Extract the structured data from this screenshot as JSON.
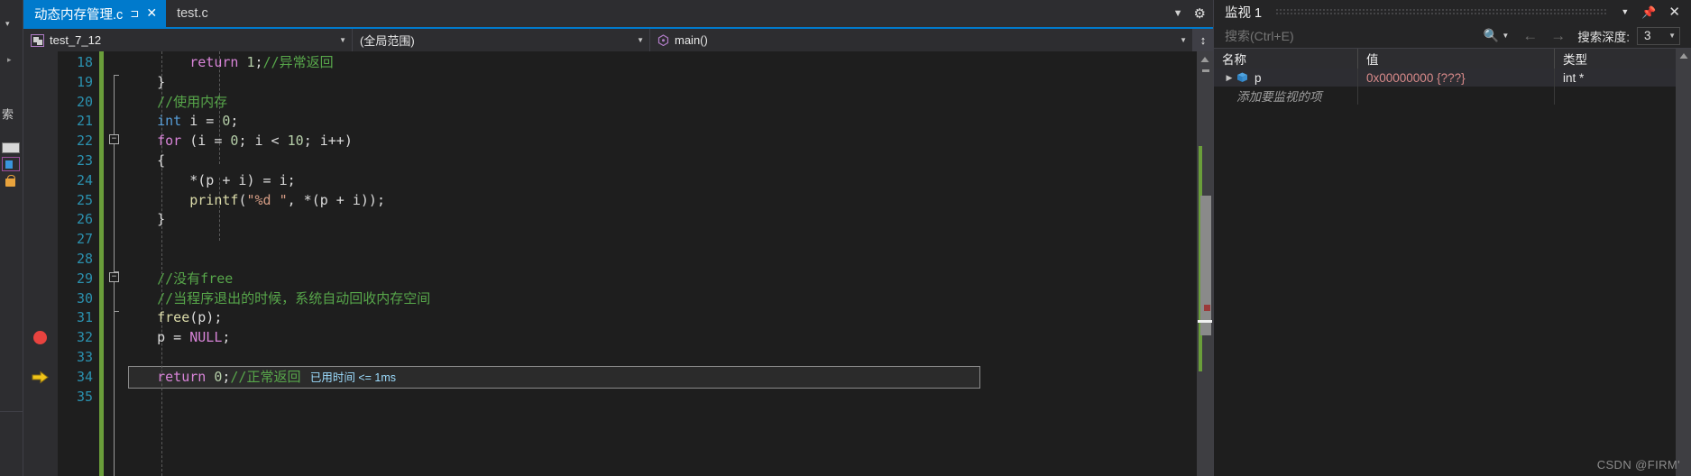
{
  "left_strip": {
    "vertical_text": "索"
  },
  "tabs": [
    {
      "label": "动态内存管理.c",
      "active": true,
      "pin_icon": "pin-icon",
      "close_icon": "close-icon"
    },
    {
      "label": "test.c",
      "active": false
    }
  ],
  "tabstrip_actions": {
    "dropdown_icon": "chevron-down-icon",
    "settings_icon": "gear-icon"
  },
  "navbar": {
    "project": "test_7_12",
    "project_icon": "project-icon",
    "scope": "(全局范围)",
    "member": "main()",
    "member_icon": "method-icon",
    "dropdown_icon": "chevron-down-icon",
    "split_icon": "split-window-icon"
  },
  "editor": {
    "first_line": 18,
    "lines": [
      {
        "n": 18,
        "tokens": [
          {
            "t": "        ",
            "c": "plain"
          },
          {
            "t": "return",
            "c": "kw"
          },
          {
            "t": " ",
            "c": "plain"
          },
          {
            "t": "1",
            "c": "num"
          },
          {
            "t": ";",
            "c": "punc"
          },
          {
            "t": "//异常返回",
            "c": "cmt"
          }
        ]
      },
      {
        "n": 19,
        "tokens": [
          {
            "t": "    }",
            "c": "punc"
          }
        ]
      },
      {
        "n": 20,
        "tokens": [
          {
            "t": "    ",
            "c": "plain"
          },
          {
            "t": "//使用内存",
            "c": "cmt"
          }
        ]
      },
      {
        "n": 21,
        "tokens": [
          {
            "t": "    ",
            "c": "plain"
          },
          {
            "t": "int",
            "c": "kw2"
          },
          {
            "t": " i = ",
            "c": "plain"
          },
          {
            "t": "0",
            "c": "num"
          },
          {
            "t": ";",
            "c": "punc"
          }
        ]
      },
      {
        "n": 22,
        "tokens": [
          {
            "t": "    ",
            "c": "plain"
          },
          {
            "t": "for",
            "c": "kw"
          },
          {
            "t": " (i = ",
            "c": "plain"
          },
          {
            "t": "0",
            "c": "num"
          },
          {
            "t": "; i < ",
            "c": "plain"
          },
          {
            "t": "10",
            "c": "num"
          },
          {
            "t": "; i++)",
            "c": "plain"
          }
        ]
      },
      {
        "n": 23,
        "tokens": [
          {
            "t": "    {",
            "c": "punc"
          }
        ]
      },
      {
        "n": 24,
        "tokens": [
          {
            "t": "        *(p + i) = i;",
            "c": "plain"
          }
        ]
      },
      {
        "n": 25,
        "tokens": [
          {
            "t": "        ",
            "c": "plain"
          },
          {
            "t": "printf",
            "c": "fn"
          },
          {
            "t": "(",
            "c": "punc"
          },
          {
            "t": "\"%d \"",
            "c": "str"
          },
          {
            "t": ", *(p + i));",
            "c": "plain"
          }
        ]
      },
      {
        "n": 26,
        "tokens": [
          {
            "t": "    }",
            "c": "punc"
          }
        ]
      },
      {
        "n": 27,
        "tokens": [
          {
            "t": "",
            "c": "plain"
          }
        ]
      },
      {
        "n": 28,
        "tokens": [
          {
            "t": "",
            "c": "plain"
          }
        ]
      },
      {
        "n": 29,
        "tokens": [
          {
            "t": "    ",
            "c": "plain"
          },
          {
            "t": "//没有free",
            "c": "cmt"
          }
        ]
      },
      {
        "n": 30,
        "tokens": [
          {
            "t": "    ",
            "c": "plain"
          },
          {
            "t": "//当程序退出的时候，系统自动回收内存空间",
            "c": "cmt"
          }
        ]
      },
      {
        "n": 31,
        "tokens": [
          {
            "t": "    ",
            "c": "plain"
          },
          {
            "t": "free",
            "c": "fn"
          },
          {
            "t": "(p);",
            "c": "plain"
          }
        ]
      },
      {
        "n": 32,
        "tokens": [
          {
            "t": "    p = ",
            "c": "plain"
          },
          {
            "t": "NULL",
            "c": "kw"
          },
          {
            "t": ";",
            "c": "punc"
          }
        ]
      },
      {
        "n": 33,
        "tokens": [
          {
            "t": "",
            "c": "plain"
          }
        ]
      },
      {
        "n": 34,
        "tokens": [
          {
            "t": "    ",
            "c": "plain"
          },
          {
            "t": "return",
            "c": "kw"
          },
          {
            "t": " ",
            "c": "plain"
          },
          {
            "t": "0",
            "c": "num"
          },
          {
            "t": ";",
            "c": "punc"
          },
          {
            "t": "//正常返回",
            "c": "cmt"
          }
        ]
      },
      {
        "n": 35,
        "tokens": [
          {
            "t": "",
            "c": "plain"
          }
        ]
      }
    ],
    "breakpoint_line": 32,
    "current_line": 34,
    "breakpoint_icon": "breakpoint-icon",
    "current_statement_icon": "execution-pointer-icon",
    "datatip": "已用时间 <= 1ms"
  },
  "watch": {
    "title": "监视 1",
    "dropdown_icon": "chevron-down-icon",
    "pin_icon": "pin-icon",
    "close_icon": "close-icon",
    "search_placeholder": "搜索(Ctrl+E)",
    "search_value": "",
    "search_icon": "magnifier-icon",
    "search_caret_icon": "chevron-down-icon",
    "prev_icon": "arrow-left-icon",
    "next_icon": "arrow-right-icon",
    "depth_label": "搜索深度:",
    "depth_value": "3",
    "columns": [
      "名称",
      "值",
      "类型"
    ],
    "rows": [
      {
        "name": "p",
        "value": "0x00000000 {???}",
        "type": "int *",
        "expander_icon": "expand-triangle-icon",
        "type_icon": "variable-cube-icon"
      }
    ],
    "add_row_placeholder": "添加要监视的项"
  },
  "watermark": "CSDN @FIRM'",
  "colors": {
    "accent": "#007acc",
    "breakpoint": "#e8433f",
    "execution_pointer": "#f0c419",
    "comment": "#57a64a",
    "keyword": "#d884d8",
    "linenumber": "#2b91af",
    "string": "#d69d85",
    "value_text": "#d98a8a"
  }
}
